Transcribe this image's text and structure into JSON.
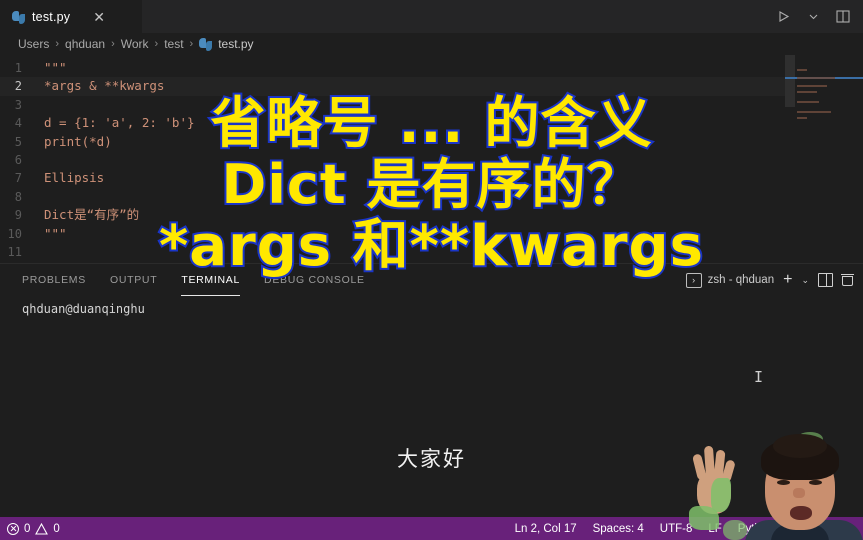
{
  "window": {
    "tab": {
      "label": "test.py",
      "icon": "python-file-icon",
      "close": "✕"
    },
    "actions": {
      "run": "▷",
      "run_dropdown": "⌄",
      "layout": "▯"
    }
  },
  "breadcrumb": {
    "items": [
      "Users",
      "qhduan",
      "Work",
      "test",
      "test.py"
    ],
    "separator": "›"
  },
  "editor": {
    "lines": [
      {
        "no": "1",
        "text": "\"\"\""
      },
      {
        "no": "2",
        "text": "*args & **kwargs",
        "active": true
      },
      {
        "no": "3",
        "text": ""
      },
      {
        "no": "4",
        "text": "d = {1: 'a', 2: 'b'}"
      },
      {
        "no": "5",
        "text": "print(*d)"
      },
      {
        "no": "6",
        "text": ""
      },
      {
        "no": "7",
        "text": "Ellipsis"
      },
      {
        "no": "8",
        "text": ""
      },
      {
        "no": "9",
        "text": "Dict是“有序”的"
      },
      {
        "no": "10",
        "text": "\"\"\""
      },
      {
        "no": "11",
        "text": ""
      }
    ]
  },
  "panel": {
    "tabs": [
      {
        "label": "PROBLEMS",
        "active": false
      },
      {
        "label": "OUTPUT",
        "active": false
      },
      {
        "label": "TERMINAL",
        "active": true
      },
      {
        "label": "DEBUG CONSOLE",
        "active": false
      }
    ],
    "terminal_select": {
      "label": "zsh - qhduan",
      "icon": "terminal-icon",
      "glyph": "›"
    },
    "actions": {
      "new_terminal": "+",
      "new_terminal_dropdown": "⌄",
      "split_terminal": "split-icon",
      "kill_terminal": "trash-icon"
    },
    "terminal_prompt": "qhduan@duanqinghu"
  },
  "statusbar": {
    "errors": "0",
    "warnings": "0",
    "items": [
      {
        "label": "Ln 2, Col 17"
      },
      {
        "label": "Spaces: 4"
      },
      {
        "label": "UTF-8"
      },
      {
        "label": "LF"
      },
      {
        "label": "Python"
      },
      {
        "label": "?"
      }
    ],
    "background": "#68217a",
    "bell": "bell-icon",
    "account": "account-icon"
  },
  "overlay": {
    "subtitles": [
      "省略号 ... 的含义",
      "Dict 是有序的？",
      "*args 和**kwargs"
    ],
    "colors": {
      "fill": "#ffe800",
      "stroke": "#1a35c8"
    },
    "caption": "大家好"
  }
}
